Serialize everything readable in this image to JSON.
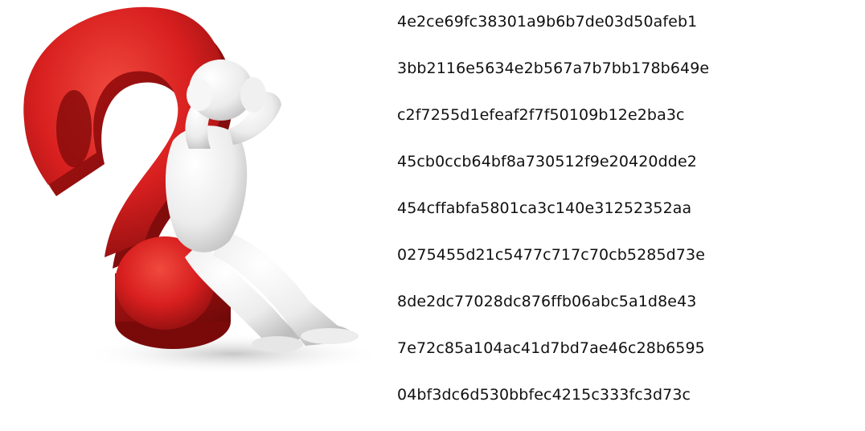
{
  "illustration": {
    "description_icon": "question-mark-figure-icon",
    "accent_color": "#d81f1f",
    "figure_color": "#f2f2f2"
  },
  "hashes": [
    "4e2ce69fc38301a9b6b7de03d50afeb1",
    "3bb2116e5634e2b567a7b7bb178b649e",
    "c2f7255d1efeaf2f7f50109b12e2ba3c",
    "45cb0ccb64bf8a730512f9e20420dde2",
    "454cffabfa5801ca3c140e31252352aa",
    "0275455d21c5477c717c70cb5285d73e",
    "8de2dc77028dc876ffb06abc5a1d8e43",
    "7e72c85a104ac41d7bd7ae46c28b6595",
    "04bf3dc6d530bbfec4215c333fc3d73c"
  ]
}
